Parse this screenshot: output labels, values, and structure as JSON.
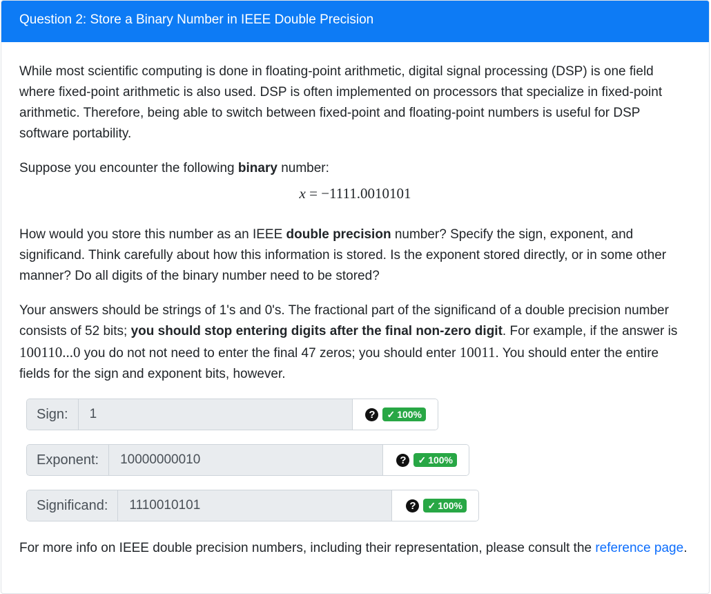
{
  "header": {
    "title": "Question 2: Store a Binary Number in IEEE Double Precision"
  },
  "paragraphs": {
    "p1": "While most scientific computing is done in floating-point arithmetic, digital signal processing (DSP) is one field where fixed-point arithmetic is also used. DSP is often implemented on processors that specialize in fixed-point arithmetic. Therefore, being able to switch between fixed-point and floating-point numbers is useful for DSP software portability.",
    "p2_before": "Suppose you encounter the following ",
    "p2_bold": "binary",
    "p2_after": " number:",
    "equation_var": "x",
    "equation_rest": " = −1111.0010101",
    "p3_before": "How would you store this number as an IEEE ",
    "p3_bold": "double precision",
    "p3_after": " number? Specify the sign, exponent, and significand. Think carefully about how this information is stored. Is the exponent stored directly, or in some other manner? Do all digits of the binary number need to be stored?",
    "p4_a": "Your answers should be strings of 1's and 0's. The fractional part of the significand of a double precision number consists of 52 bits; ",
    "p4_bold": "you should stop entering digits after the final non-zero digit",
    "p4_b": ". For example, if the answer is ",
    "p4_math1": "100110...0",
    "p4_c": " you do not not need to enter the final 47 zeros; you should enter ",
    "p4_math2": "10011",
    "p4_d": ". You should enter the entire fields for the sign and exponent bits, however.",
    "footer_before": "For more info on IEEE double precision numbers, including their representation, please consult the ",
    "footer_link": "reference page",
    "footer_after": "."
  },
  "answers": {
    "sign": {
      "label": "Sign:",
      "value": "1",
      "score": "100%"
    },
    "exponent": {
      "label": "Exponent:",
      "value": "10000000010",
      "score": "100%"
    },
    "significand": {
      "label": "Significand:",
      "value": "1110010101",
      "score": "100%"
    }
  },
  "icons": {
    "help": "question-circle-icon",
    "check": "check-icon"
  },
  "colors": {
    "header_bg": "#0d7bf5",
    "badge_bg": "#28a745",
    "link": "#0d6efd"
  }
}
